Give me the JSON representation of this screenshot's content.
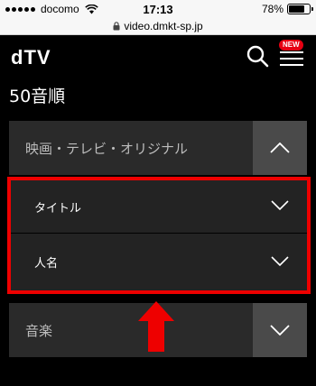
{
  "status_bar": {
    "carrier": "docomo",
    "time": "17:13",
    "battery_label": "78%",
    "battery_level": 0.78,
    "signal_bars": 5
  },
  "url_bar": {
    "url": "video.dmkt-sp.jp"
  },
  "header": {
    "logo": "dTV",
    "new_badge": "NEW"
  },
  "page": {
    "title": "50音順"
  },
  "accordion": {
    "sections": [
      {
        "label": "映画・テレビ・オリジナル",
        "expanded": true,
        "items": [
          {
            "label": "タイトル"
          },
          {
            "label": "人名"
          }
        ]
      },
      {
        "label": "音楽",
        "expanded": false
      }
    ]
  },
  "annotation": {
    "highlight_color": "#ee0000"
  },
  "colors": {
    "background": "#000000",
    "brand_red": "#e60012",
    "section_bg": "#2a2a2a",
    "toggle_bg": "#4a4a4a"
  }
}
